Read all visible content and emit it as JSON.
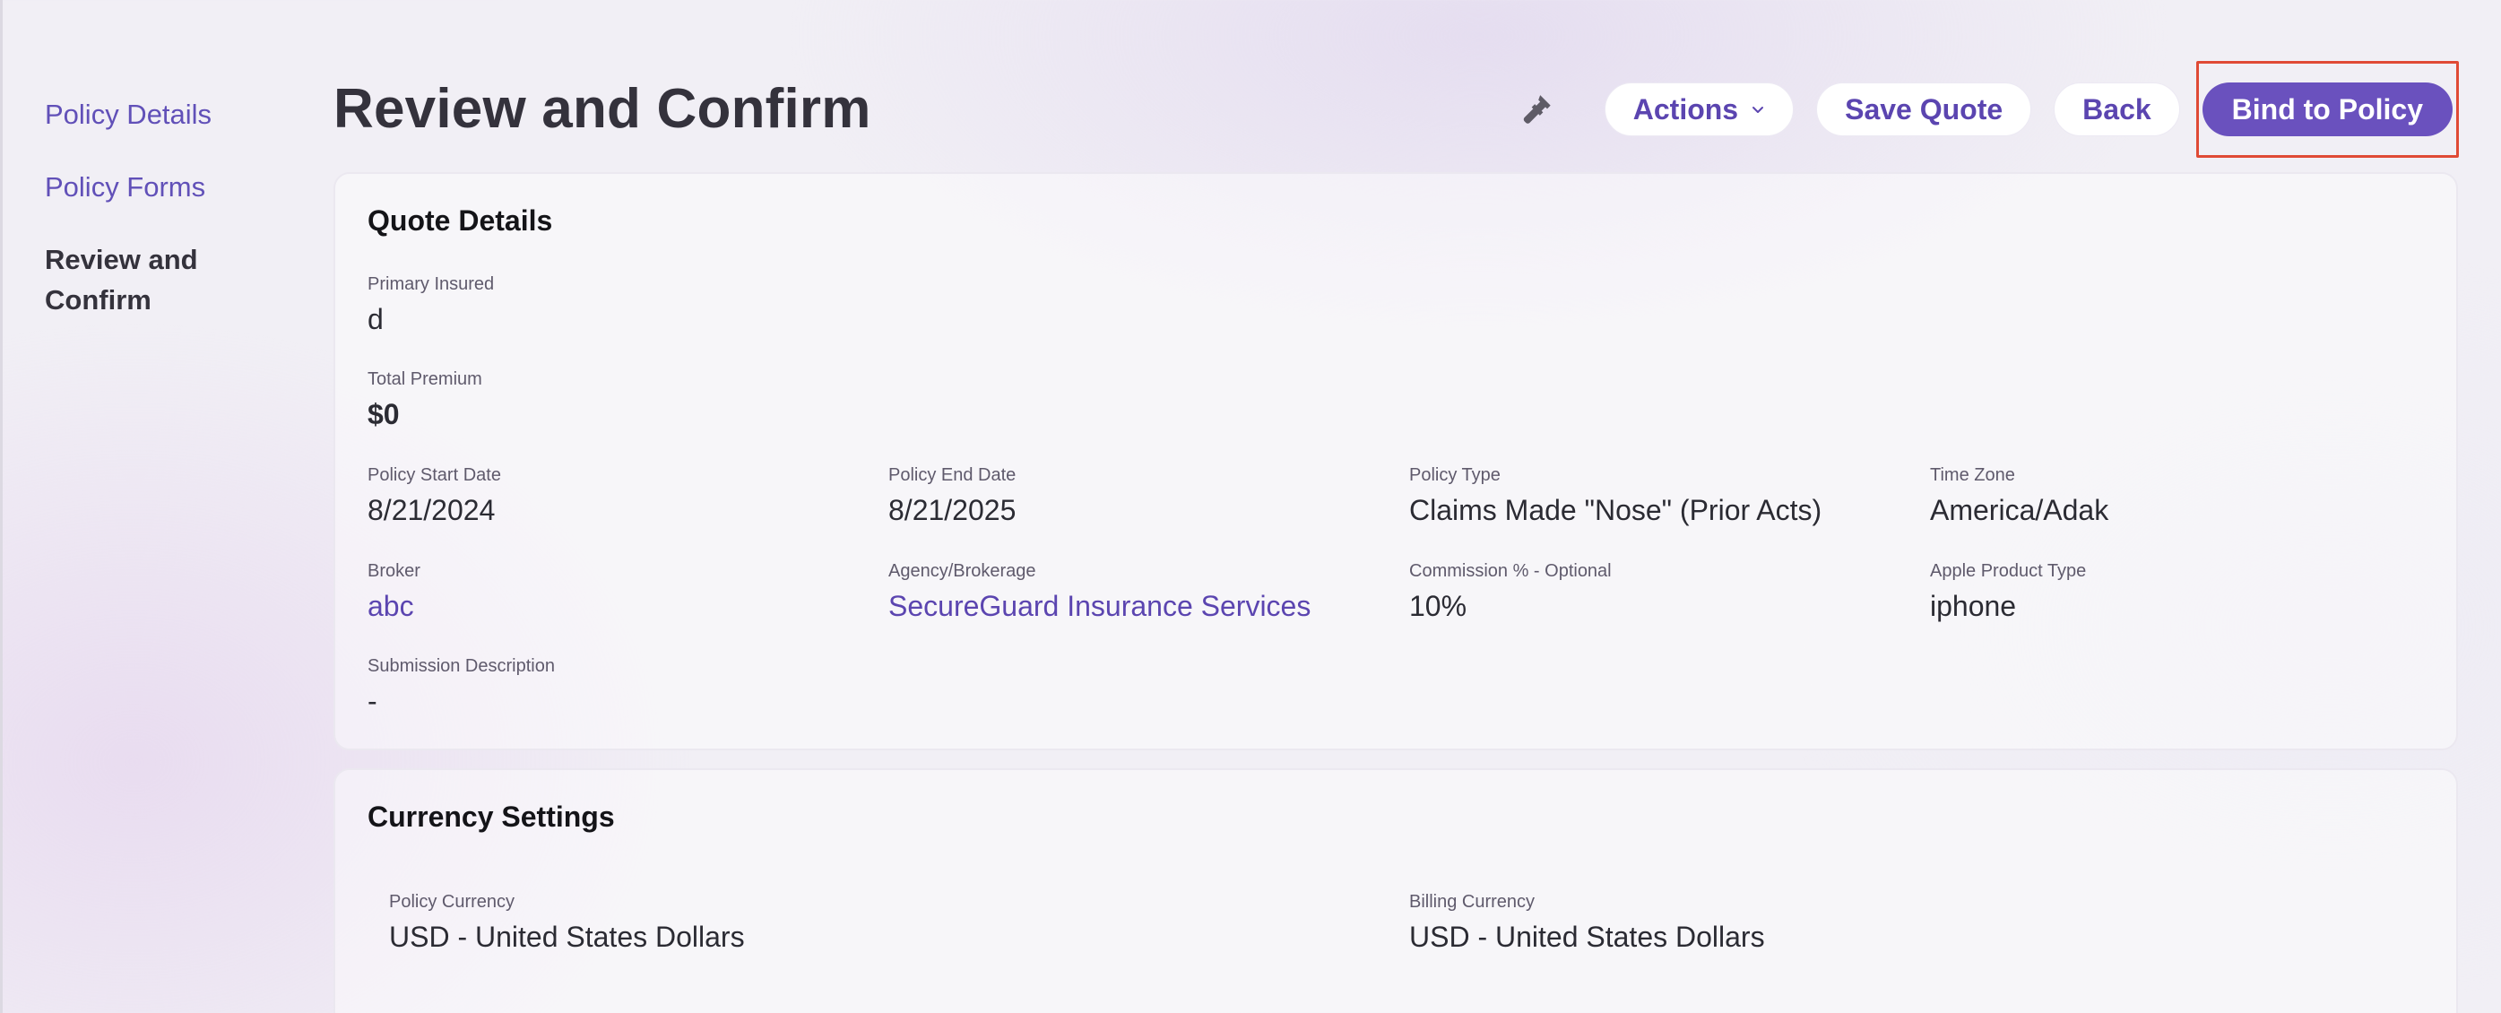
{
  "sidebar": {
    "items": [
      {
        "label": "Policy Details"
      },
      {
        "label": "Policy Forms"
      },
      {
        "label": "Review and Confirm"
      }
    ]
  },
  "header": {
    "title": "Review and Confirm",
    "actions_label": "Actions",
    "save_quote_label": "Save Quote",
    "back_label": "Back",
    "bind_label": "Bind to Policy",
    "accent_color": "#6a51be"
  },
  "quote_details": {
    "title": "Quote Details",
    "primary_insured": {
      "label": "Primary Insured",
      "value": "d"
    },
    "total_premium": {
      "label": "Total Premium",
      "value": "$0"
    },
    "policy_start_date": {
      "label": "Policy Start Date",
      "value": "8/21/2024"
    },
    "policy_end_date": {
      "label": "Policy End Date",
      "value": "8/21/2025"
    },
    "policy_type": {
      "label": "Policy Type",
      "value": "Claims Made \"Nose\" (Prior Acts)"
    },
    "time_zone": {
      "label": "Time Zone",
      "value": "America/Adak"
    },
    "broker": {
      "label": "Broker",
      "value": "abc"
    },
    "agency": {
      "label": "Agency/Brokerage",
      "value": "SecureGuard Insurance Services"
    },
    "commission": {
      "label": "Commission % - Optional",
      "value": "10%"
    },
    "apple_product_type": {
      "label": "Apple Product Type",
      "value": "iphone"
    },
    "submission_description": {
      "label": "Submission Description",
      "value": "-"
    }
  },
  "currency_settings": {
    "title": "Currency Settings",
    "policy_currency": {
      "label": "Policy Currency",
      "value": "USD - United States Dollars"
    },
    "billing_currency": {
      "label": "Billing Currency",
      "value": "USD - United States Dollars"
    }
  }
}
